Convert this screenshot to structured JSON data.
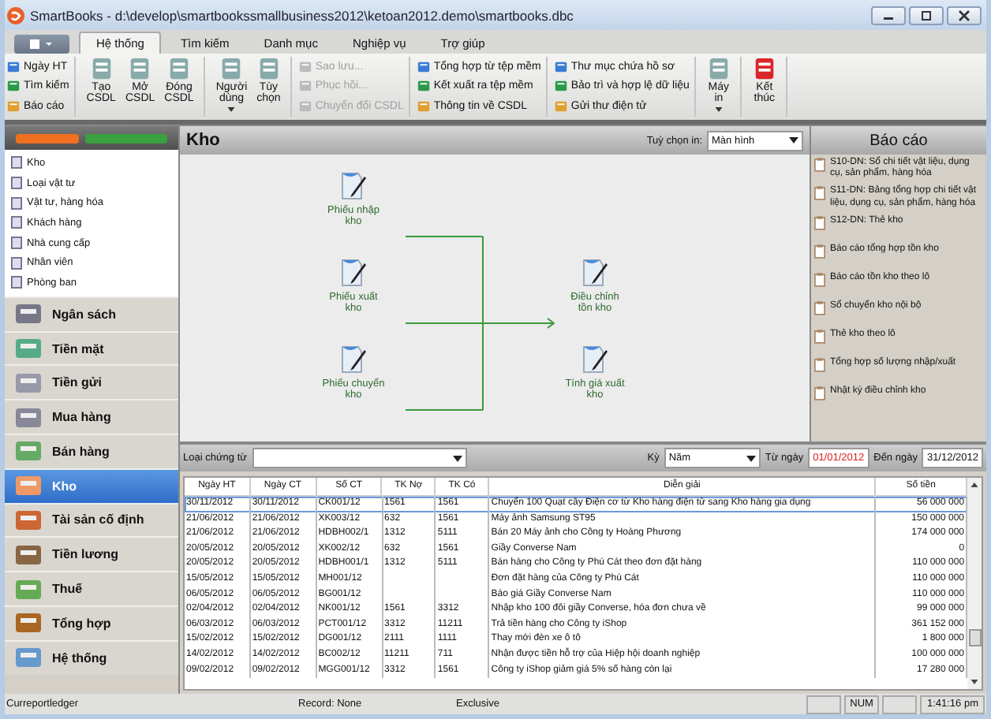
{
  "window": {
    "title": "SmartBooks - d:\\develop\\smartbookssmallbusiness2012\\ketoan2012.demo\\smartbooks.dbc"
  },
  "tabs": [
    {
      "label": "Hệ thống",
      "selected": true
    },
    {
      "label": "Tìm kiếm",
      "selected": false
    },
    {
      "label": "Danh mục",
      "selected": false
    },
    {
      "label": "Nghiệp vụ",
      "selected": false
    },
    {
      "label": "Trợ giúp",
      "selected": false
    }
  ],
  "ribbon": {
    "groups": [
      {
        "kind": "small",
        "items": [
          {
            "label": "Ngày HT",
            "disabled": false
          },
          {
            "label": "Tìm kiếm",
            "disabled": false
          },
          {
            "label": "Báo cáo",
            "disabled": false
          }
        ]
      },
      {
        "kind": "large",
        "items": [
          {
            "label": "Tạo\nCSDL",
            "dropdown": false
          },
          {
            "label": "Mở\nCSDL",
            "dropdown": false
          },
          {
            "label": "Đóng\nCSDL",
            "dropdown": false
          }
        ]
      },
      {
        "kind": "large",
        "items": [
          {
            "label": "Người\ndùng",
            "dropdown": true
          },
          {
            "label": "Tùy\nchọn",
            "dropdown": false
          }
        ]
      },
      {
        "kind": "small",
        "items": [
          {
            "label": "Sao lưu...",
            "disabled": true
          },
          {
            "label": "Phục hồi...",
            "disabled": true
          },
          {
            "label": "Chuyển đổi CSDL",
            "disabled": true
          }
        ]
      },
      {
        "kind": "small",
        "items": [
          {
            "label": "Tổng hợp từ tệp mềm",
            "disabled": false
          },
          {
            "label": "Kết xuất ra tệp mềm",
            "disabled": false
          },
          {
            "label": "Thông tin về CSDL",
            "disabled": false
          }
        ]
      },
      {
        "kind": "small",
        "items": [
          {
            "label": "Thư mục chứa hồ sơ",
            "disabled": false
          },
          {
            "label": "Bảo trì và hợp lệ dữ liệu",
            "disabled": false
          },
          {
            "label": "Gửi thư điện tử",
            "disabled": false
          }
        ]
      },
      {
        "kind": "large",
        "items": [
          {
            "label": "Máy\nin",
            "dropdown": true
          }
        ]
      },
      {
        "kind": "large",
        "items": [
          {
            "label": "Kết\nthúc",
            "dropdown": false
          }
        ]
      }
    ]
  },
  "sidebar": {
    "list": [
      "Kho",
      "Loại vật tư",
      "Vật tư, hàng hóa",
      "Khách hàng",
      "Nhà cung cấp",
      "Nhân viên",
      "Phòng ban"
    ],
    "nav": [
      {
        "label": "Ngân sách",
        "selected": false
      },
      {
        "label": "Tiền mặt",
        "selected": false
      },
      {
        "label": "Tiền gửi",
        "selected": false
      },
      {
        "label": "Mua hàng",
        "selected": false
      },
      {
        "label": "Bán hàng",
        "selected": false
      },
      {
        "label": "Kho",
        "selected": true
      },
      {
        "label": "Tài sản cố định",
        "selected": false
      },
      {
        "label": "Tiền lương",
        "selected": false
      },
      {
        "label": "Thuế",
        "selected": false
      },
      {
        "label": "Tổng hợp",
        "selected": false
      },
      {
        "label": "Hệ thống",
        "selected": false
      }
    ]
  },
  "panel": {
    "title": "Kho",
    "print_option": {
      "label": "Tuỳ chọn in:",
      "value": "Màn hình"
    }
  },
  "diagram": {
    "left": [
      "Phiếu nhập\nkho",
      "Phiếu xuất\nkho",
      "Phiếu chuyển\nkho"
    ],
    "right": [
      "Điều chỉnh\ntồn kho",
      "Tính giá xuất\nkho"
    ]
  },
  "reports": {
    "title": "Báo cáo",
    "items": [
      "S10-DN: Sổ chi tiết vật liệu, dụng cụ, sản phẩm, hàng hóa",
      "S11-DN: Bảng tổng hợp chi tiết vật liệu, dụng cụ, sản phẩm, hàng hóa",
      "S12-DN: Thẻ kho",
      "Báo cáo tổng hợp tồn kho",
      "Báo cáo tồn kho theo lô",
      "Sổ chuyển kho nội bộ",
      "Thẻ kho theo lô",
      "Tổng hợp số lượng nhập/xuất",
      "Nhật ký điều chỉnh kho"
    ]
  },
  "filter": {
    "doc_type": {
      "label": "Loại chứng từ"
    },
    "period": {
      "label": "Kỳ",
      "value": "Năm"
    },
    "from_date": {
      "label": "Từ ngày",
      "value": "01/01/2012",
      "highlighted": true
    },
    "to_date": {
      "label": "Đến ngày",
      "value": "31/12/2012",
      "highlighted": false
    }
  },
  "table": {
    "columns": [
      "Ngày HT",
      "Ngày CT",
      "Số CT",
      "TK Nợ",
      "TK Có",
      "Diễn giải",
      "Số tiền"
    ],
    "rows": [
      {
        "cells": [
          "30/11/2012",
          "30/11/2012",
          "CK001/12",
          "1561",
          "1561",
          "Chuyển 100 Quạt cây Điện cơ từ Kho hàng điện tử sang Kho hàng gia dụng",
          "56 000 000"
        ],
        "selected": true
      },
      {
        "cells": [
          "21/06/2012",
          "21/06/2012",
          "XK003/12",
          "632",
          "1561",
          "Máy ảnh Samsung ST95",
          "150 000 000"
        ],
        "selected": false
      },
      {
        "cells": [
          "21/06/2012",
          "21/06/2012",
          "HDBH002/1",
          "1312",
          "5111",
          "Bán 20 Máy ảnh cho Công ty Hoàng Phương",
          "174 000 000"
        ],
        "selected": false
      },
      {
        "cells": [
          "20/05/2012",
          "20/05/2012",
          "XK002/12",
          "632",
          "1561",
          "Giầy Converse Nam",
          "0"
        ],
        "selected": false
      },
      {
        "cells": [
          "20/05/2012",
          "20/05/2012",
          "HDBH001/1",
          "1312",
          "5111",
          "Bán hàng cho Công ty Phú Cát theo đơn đặt hàng",
          "110 000 000"
        ],
        "selected": false
      },
      {
        "cells": [
          "15/05/2012",
          "15/05/2012",
          "MH001/12",
          "",
          "",
          "Đơn đặt hàng của Công ty Phú Cát",
          "110 000 000"
        ],
        "selected": false
      },
      {
        "cells": [
          "06/05/2012",
          "06/05/2012",
          "BG001/12",
          "",
          "",
          "Báo giá Giầy Converse Nam",
          "110 000 000"
        ],
        "selected": false
      },
      {
        "cells": [
          "02/04/2012",
          "02/04/2012",
          "NK001/12",
          "1561",
          "3312",
          "Nhập kho 100 đôi giầy Converse, hóa đơn chưa về",
          "99 000 000"
        ],
        "selected": false
      },
      {
        "cells": [
          "06/03/2012",
          "06/03/2012",
          "PCT001/12",
          "3312",
          "11211",
          "Trả tiền hàng cho Công ty iShop",
          "361 152 000"
        ],
        "selected": false
      },
      {
        "cells": [
          "15/02/2012",
          "15/02/2012",
          "DG001/12",
          "2111",
          "1111",
          "Thay mới đèn xe ô tô",
          "1 800 000"
        ],
        "selected": false
      },
      {
        "cells": [
          "14/02/2012",
          "14/02/2012",
          "BC002/12",
          "11211",
          "711",
          "Nhận được tiền hỗ trợ của Hiệp hội doanh nghiệp",
          "100 000 000"
        ],
        "selected": false
      },
      {
        "cells": [
          "09/02/2012",
          "09/02/2012",
          "MGG001/12",
          "3312",
          "1561",
          "Công ty iShop giảm giá 5% số hàng còn lại",
          "17 280 000"
        ],
        "selected": false
      }
    ]
  },
  "status_bar": {
    "report": "Curreportledger",
    "record": "Record: None",
    "mode": "Exclusive",
    "num": "NUM",
    "time": "1:41:16 pm"
  }
}
